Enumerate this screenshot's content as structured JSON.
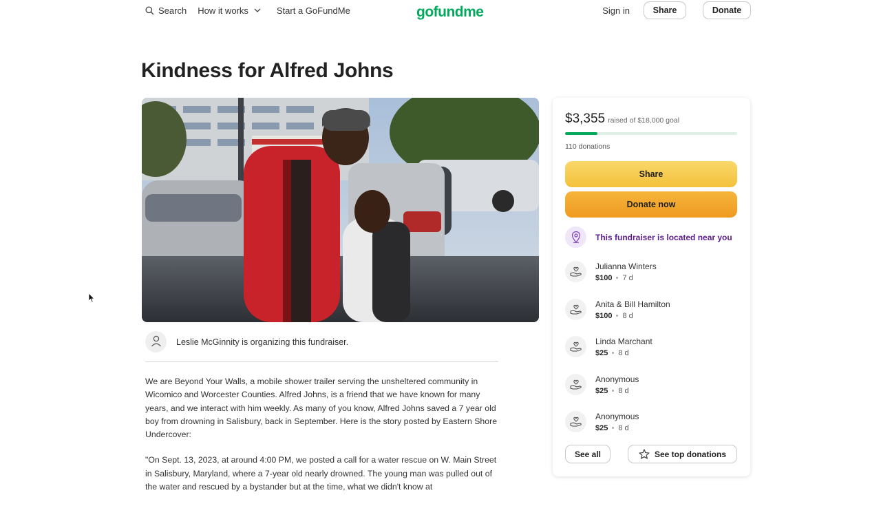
{
  "header": {
    "search_label": "Search",
    "how_it_works_label": "How it works",
    "start_label": "Start a GoFundMe",
    "logo_text": "gofundme",
    "sign_in_label": "Sign in",
    "share_label": "Share",
    "donate_label": "Donate"
  },
  "page": {
    "title": "Kindness for Alfred Johns",
    "organizer_text": "Leslie McGinnity is organizing this fundraiser.",
    "story": [
      "We are Beyond Your Walls, a mobile shower trailer serving the unsheltered community in Wicomico and Worcester Counties. Alfred Johns, is a friend that we have known for many years, and we interact with him weekly. As many of you know, Alfred Johns saved a 7 year old boy from drowning in Salisbury, back in September. Here is the story posted by Eastern Shore Undercover:",
      "\"On Sept. 13, 2023, at around 4:00 PM, we posted a call for a water rescue on W. Main Street in Salisbury, Maryland, where a 7-year old nearly drowned. The young man was pulled out of the water and rescued by a bystander but at the time, what we didn't know at"
    ]
  },
  "card": {
    "raised_amount": "$3,355",
    "raised_goal": "raised of $18,000 goal",
    "progress_fraction": 0.186,
    "donations_count": "110 donations",
    "share_label": "Share",
    "donate_now_label": "Donate now",
    "nearby_text": "This fundraiser is located near you",
    "donors": [
      {
        "name": "Julianna Winters",
        "amount": "$100",
        "time": "7 d"
      },
      {
        "name": "Anita & Bill Hamilton",
        "amount": "$100",
        "time": "8 d"
      },
      {
        "name": "Linda Marchant",
        "amount": "$25",
        "time": "8 d"
      },
      {
        "name": "Anonymous",
        "amount": "$25",
        "time": "8 d"
      },
      {
        "name": "Anonymous",
        "amount": "$25",
        "time": "8 d"
      }
    ],
    "see_all_label": "See all",
    "see_top_label": "See top donations"
  },
  "colors": {
    "brand_green": "#02a95c",
    "share_yellow": "#f4c13b",
    "donate_orange": "#ef9a20",
    "nearby_purple": "#5b1c8f"
  },
  "icons": [
    "search-icon",
    "chevron-down-icon",
    "user-icon",
    "location-pin-icon",
    "donation-hand-icon",
    "star-icon",
    "mouse-cursor-icon"
  ]
}
